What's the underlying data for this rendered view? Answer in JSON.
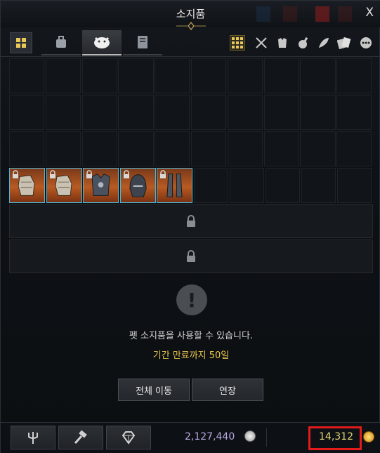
{
  "window": {
    "title": "소지품",
    "close_label": "X"
  },
  "tabs": [
    {
      "name": "bag",
      "icon": "bag-icon",
      "active": false
    },
    {
      "name": "pet",
      "icon": "pet-icon",
      "active": true
    },
    {
      "name": "book",
      "icon": "book-icon",
      "active": false
    }
  ],
  "filters": [
    {
      "icon": "grid-all-icon",
      "active": true
    },
    {
      "icon": "crossed-swords-icon",
      "active": false
    },
    {
      "icon": "armor-icon",
      "active": false
    },
    {
      "icon": "potion-icon",
      "active": false
    },
    {
      "icon": "feather-icon",
      "active": false
    },
    {
      "icon": "cards-icon",
      "active": false
    },
    {
      "icon": "more-icon",
      "active": false
    }
  ],
  "inventory": {
    "columns": 10,
    "rows": 4,
    "items": [
      {
        "slot": 30,
        "icon": "gauntlet-icon",
        "locked": true
      },
      {
        "slot": 31,
        "icon": "gauntlet-icon",
        "locked": true
      },
      {
        "slot": 32,
        "icon": "chest-armor-icon",
        "locked": true
      },
      {
        "slot": 33,
        "icon": "helmet-icon",
        "locked": true
      },
      {
        "slot": 34,
        "icon": "greaves-icon",
        "locked": true
      }
    ],
    "locked_rows": 2
  },
  "pet": {
    "message": "펫 소지품을 사용할 수 있습니다.",
    "period": "기간 만료까지 50일",
    "move_all_label": "전체 이동",
    "extend_label": "연장"
  },
  "bottom": {
    "tools": [
      "trident-icon",
      "hammer-icon",
      "gem-icon"
    ],
    "silver": "2,127,440",
    "gold": "14,312"
  },
  "colors": {
    "gold_text": "#e8c54a",
    "silver_text": "#b9a9e3",
    "highlight_box": "#e21b1b",
    "item_border": "#4fb7d6"
  }
}
